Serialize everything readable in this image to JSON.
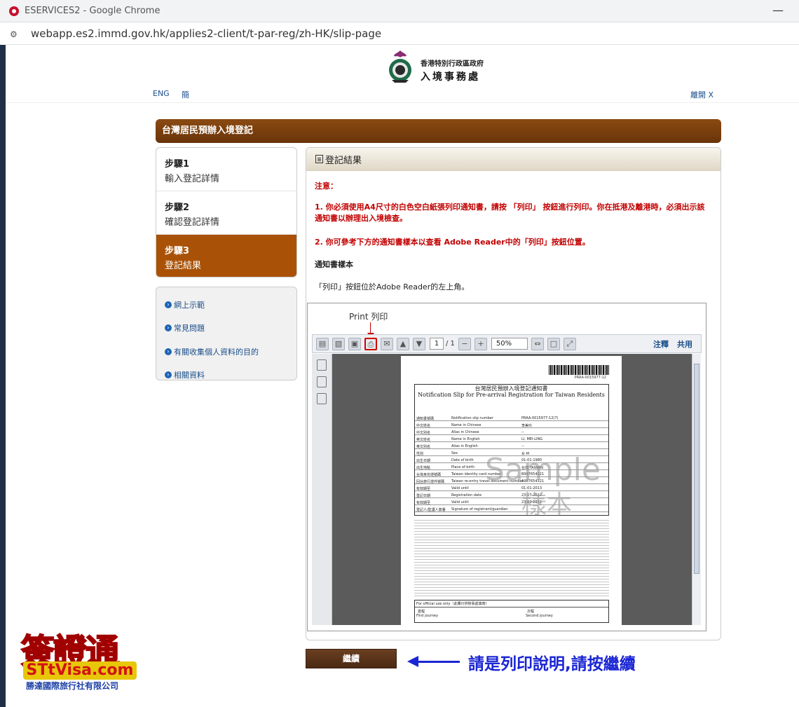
{
  "browser": {
    "title": "ESERVICES2 - Google Chrome",
    "url": "webapp.es2.immd.gov.hk/applies2-client/t-par-reg/zh-HK/slip-page"
  },
  "header": {
    "org_line1": "香港特別行政區政府",
    "org_line2": "入境事務處",
    "lang_eng": "ENG",
    "lang_simp": "簡",
    "logout": "離開 X"
  },
  "banner": {
    "title": "台灣居民預辦入境登記"
  },
  "steps": [
    {
      "title": "步驟1",
      "desc": "輸入登記詳情"
    },
    {
      "title": "步驟2",
      "desc": "確認登記詳情"
    },
    {
      "title": "步驟3",
      "desc": "登記結果"
    }
  ],
  "side_links": [
    {
      "label": "網上示範"
    },
    {
      "label": "常見問題"
    },
    {
      "label": "有關收集個人資料的目的"
    },
    {
      "label": "相關資料"
    }
  ],
  "result": {
    "header": "登記結果",
    "notice_label": "注意：",
    "notice_1": "1. 你必須使用A4尺寸的白色空白紙張列印通知書，請按 「列印」 按鈕進行列印。你在抵港及離港時，必須出示該通知書以辦理出入境檢查。",
    "notice_2": "2. 你可參考下方的通知書樣本以查看 Adobe Reader中的「列印」按鈕位置。",
    "sample_heading": "通知書樣本",
    "sample_desc": "「列印」按鈕位於Adobe Reader的左上角。"
  },
  "sample_image": {
    "print_hint": "Print 列印",
    "page_current": "1",
    "page_total": "/ 1",
    "zoom": "50%",
    "tool_comment": "注釋",
    "tool_share": "共用",
    "slip_number_small": "PRAA-0015977-12",
    "slip_title_cn": "台灣居民預辦入境登記通知書",
    "slip_title_en": "Notification Slip for Pre-arrival Registration for Taiwan Residents",
    "rows": [
      {
        "cn": "通知書號碼",
        "en": "Notification slip number",
        "val": "PRAA-0015977-12(7)"
      },
      {
        "cn": "中文姓名",
        "en": "Name in Chinese",
        "val": "李美玲"
      },
      {
        "cn": "中文別名",
        "en": "Alias in Chinese",
        "val": "--"
      },
      {
        "cn": "英文姓名",
        "en": "Name in English",
        "val": "LI, MEI-LING"
      },
      {
        "cn": "英文別名",
        "en": "Alias in English",
        "val": "--"
      },
      {
        "cn": "性別",
        "en": "Sex",
        "val": "女 M"
      },
      {
        "cn": "出生日期",
        "en": "Date of birth",
        "val": "01-01-1980"
      },
      {
        "cn": "出生地點",
        "en": "Place of birth",
        "val": "台灣 TAIWAN"
      },
      {
        "cn": "台灣身份證號碼",
        "en": "Taiwan identity card number",
        "val": "B987654321"
      },
      {
        "cn": "回台旅行證件號碼",
        "en": "Taiwan re-entry travel document number",
        "val": "A987654321"
      },
      {
        "cn": "有效期至",
        "en": "Valid until",
        "val": "01-01-2013"
      },
      {
        "cn": "登記日期",
        "en": "Registration date",
        "val": "23-07-2012"
      },
      {
        "cn": "有效期至",
        "en": "Valid until",
        "val": "23-09-2012"
      },
      {
        "cn": "登記人/監護人簽署",
        "en": "Signature of registrant/guardian",
        "val": ""
      }
    ],
    "official_use": "For official use only（此欄只供辦事處填寫）",
    "first_journey_cn": "首程",
    "first_journey_en": "First journey",
    "second_journey_cn": "次程",
    "second_journey_en": "Second journey",
    "watermark_en": "Sample",
    "watermark_cn": "樣本"
  },
  "actions": {
    "continue_label": "繼續"
  },
  "annotation": {
    "instruction": "請是列印說明,請按繼續"
  },
  "brand": {
    "name_cn": "簽證通",
    "name_en": "STtVisa.com",
    "company": "勝達國際旅行社有限公司"
  }
}
